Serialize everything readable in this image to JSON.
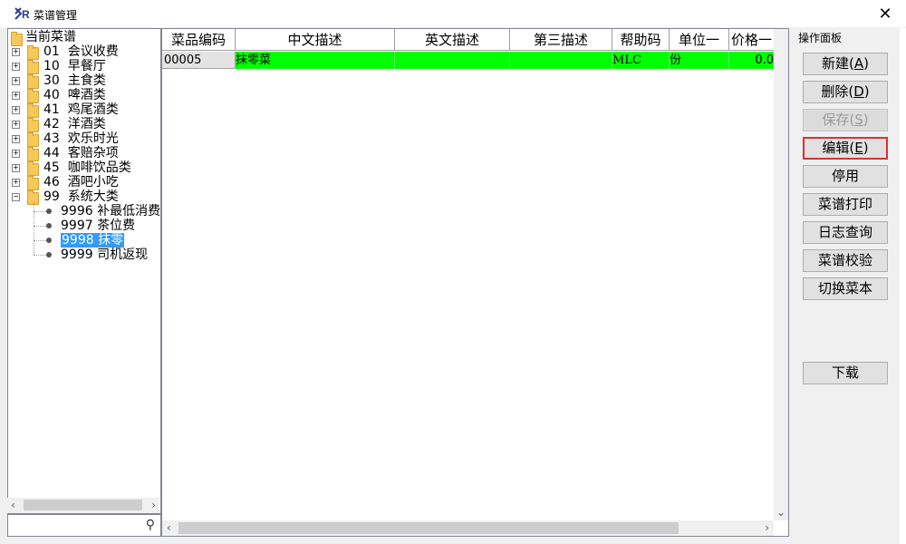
{
  "window": {
    "title": "菜谱管理",
    "close_glyph": "✕"
  },
  "tree": {
    "root": "当前菜谱",
    "categories": [
      {
        "code": "01",
        "name": "会议收费"
      },
      {
        "code": "10",
        "name": "早餐厅"
      },
      {
        "code": "30",
        "name": "主食类"
      },
      {
        "code": "40",
        "name": "啤酒类"
      },
      {
        "code": "41",
        "name": "鸡尾酒类"
      },
      {
        "code": "42",
        "name": "洋酒类"
      },
      {
        "code": "43",
        "name": "欢乐时光"
      },
      {
        "code": "44",
        "name": "客赔杂项"
      },
      {
        "code": "45",
        "name": "咖啡饮品类"
      },
      {
        "code": "46",
        "name": "酒吧小吃"
      },
      {
        "code": "99",
        "name": "系统大类"
      }
    ],
    "children": [
      {
        "code": "9996",
        "name": "补最低消费"
      },
      {
        "code": "9997",
        "name": "茶位费"
      },
      {
        "code": "9998",
        "name": "抹零",
        "selected": true
      },
      {
        "code": "9999",
        "name": "司机返现"
      }
    ]
  },
  "grid": {
    "columns": [
      "菜品编码",
      "中文描述",
      "英文描述",
      "第三描述",
      "帮助码",
      "单位一",
      "价格一"
    ],
    "rows": [
      {
        "code": "00005",
        "cn": "抹零菜",
        "en": "",
        "third": "",
        "help": "MLC",
        "unit": "份",
        "price": "0.0"
      }
    ],
    "row_highlight_color": "#00ff00"
  },
  "ops": {
    "title": "操作面板",
    "buttons": [
      {
        "label": "新建",
        "key": "A",
        "state": "normal"
      },
      {
        "label": "删除",
        "key": "D",
        "state": "normal"
      },
      {
        "label": "保存",
        "key": "S",
        "state": "disabled"
      },
      {
        "label": "编辑",
        "key": "E",
        "state": "highlighted"
      },
      {
        "label": "停用",
        "key": "",
        "state": "normal"
      },
      {
        "label": "菜谱打印",
        "key": "",
        "state": "normal"
      },
      {
        "label": "日志查询",
        "key": "",
        "state": "normal"
      },
      {
        "label": "菜谱校验",
        "key": "",
        "state": "normal"
      },
      {
        "label": "切换菜本",
        "key": "",
        "state": "normal"
      },
      {
        "label": "下载",
        "key": "",
        "state": "normal"
      }
    ],
    "highlight_color": "#e03030"
  }
}
